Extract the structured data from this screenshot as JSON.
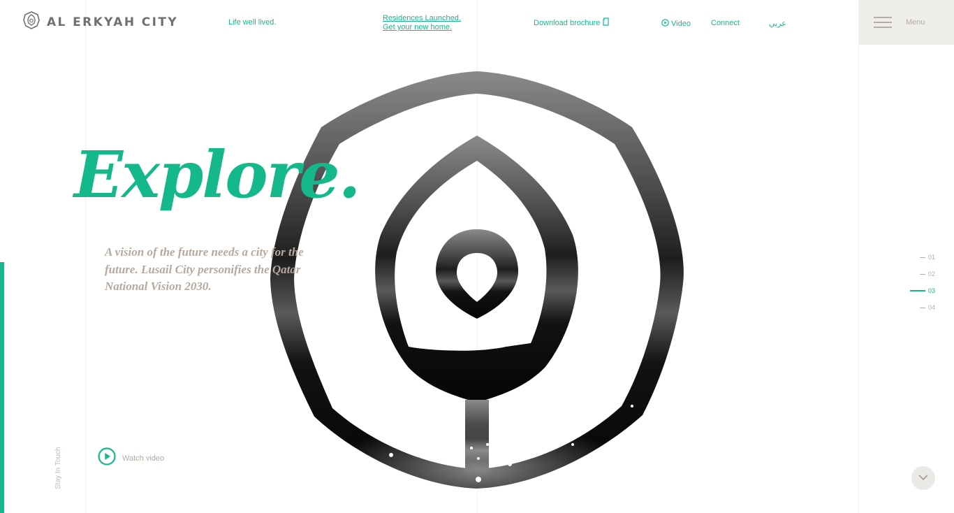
{
  "brand": {
    "name": "AL ERKYAH CITY",
    "logo_icon": "leaf-emblem-icon"
  },
  "nav": {
    "tagline": "Life well lived.",
    "residences_line1": "Residences Launched.",
    "residences_line2": "Get your new home.",
    "brochure": "Download brochure",
    "brochure_icon": "document-icon",
    "video": "Video",
    "video_icon": "play-circle-icon",
    "connect": "Connect",
    "language": "عربي"
  },
  "menu": {
    "label": "Menu",
    "icon": "hamburger-icon"
  },
  "hero": {
    "headline": "Explore.",
    "subtext": "A vision of the future needs a city for the future. Lusail City personifies the Qatar National Vision 2030.",
    "watch_video": "Watch video"
  },
  "side": {
    "stay_in_touch": "Stay In Touch"
  },
  "pager": {
    "items": [
      "01",
      "02",
      "03",
      "04"
    ],
    "active": "03"
  },
  "scroll_down_icon": "chevron-down-icon",
  "colors": {
    "accent": "#14b88a",
    "muted_text": "#b7a89e",
    "menu_bg": "#efeeea"
  }
}
